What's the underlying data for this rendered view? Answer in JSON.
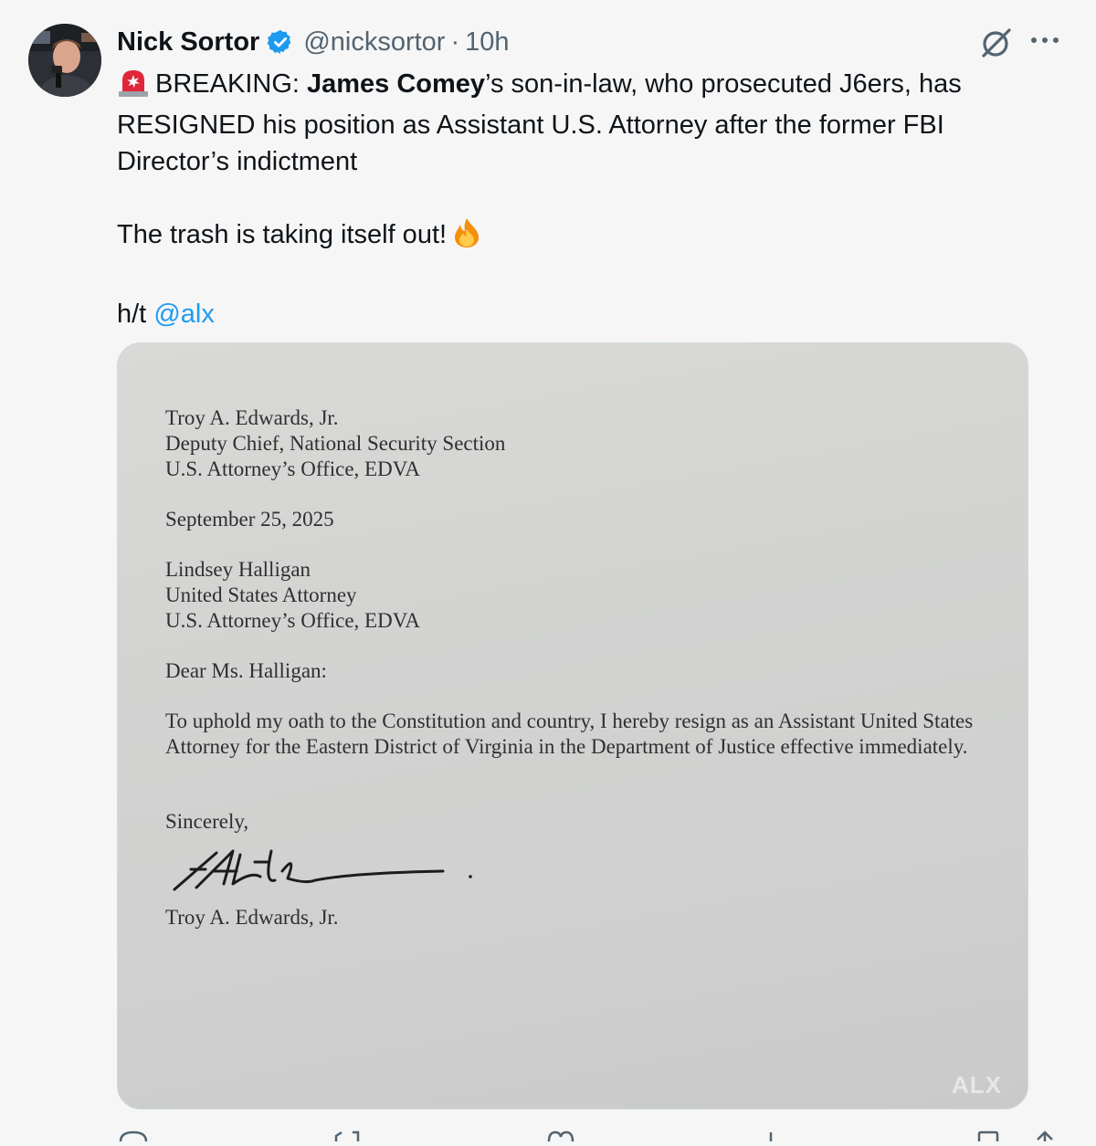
{
  "tweet": {
    "author_name": "Nick Sortor",
    "handle": "@nicksortor",
    "separator": "·",
    "time": "10h",
    "lines": {
      "prefix": "BREAKING: ",
      "bold_name": "James Comey",
      "rest": "’s son-in-law, who prosecuted J6ers, has RESIGNED his position as Assistant U.S. Attorney after the former FBI Director’s indictment",
      "second": "The trash is taking itself out!",
      "ht_prefix": "h/t ",
      "mention": "@alx"
    }
  },
  "letter": {
    "sender_name": "Troy A. Edwards, Jr.",
    "sender_title": "Deputy Chief, National Security Section",
    "sender_office": "U.S. Attorney’s Office, EDVA",
    "date": "September 25, 2025",
    "recipient_name": "Lindsey Halligan",
    "recipient_title": "United States Attorney",
    "recipient_office": "U.S. Attorney’s Office, EDVA",
    "salutation": "Dear Ms. Halligan:",
    "body_line_1": "To uphold my oath to the Constitution and country, I hereby resign as an Assistant United States",
    "body_line_2": "Attorney for the Eastern District of Virginia in the Department of Justice effective immediately.",
    "closing": "Sincerely,",
    "signature_name": "Troy A. Edwards, Jr."
  },
  "watermark": "ALX",
  "icons": {
    "verified": "verified-badge-icon",
    "grok": "grok-icon",
    "more": "more-options-icon",
    "siren": "rotating-light-emoji",
    "fire": "fire-emoji"
  },
  "colors": {
    "link": "#1d9bf0",
    "verified": "#1d9bf0",
    "secondary_text": "#536471",
    "primary_text": "#0f1419"
  }
}
